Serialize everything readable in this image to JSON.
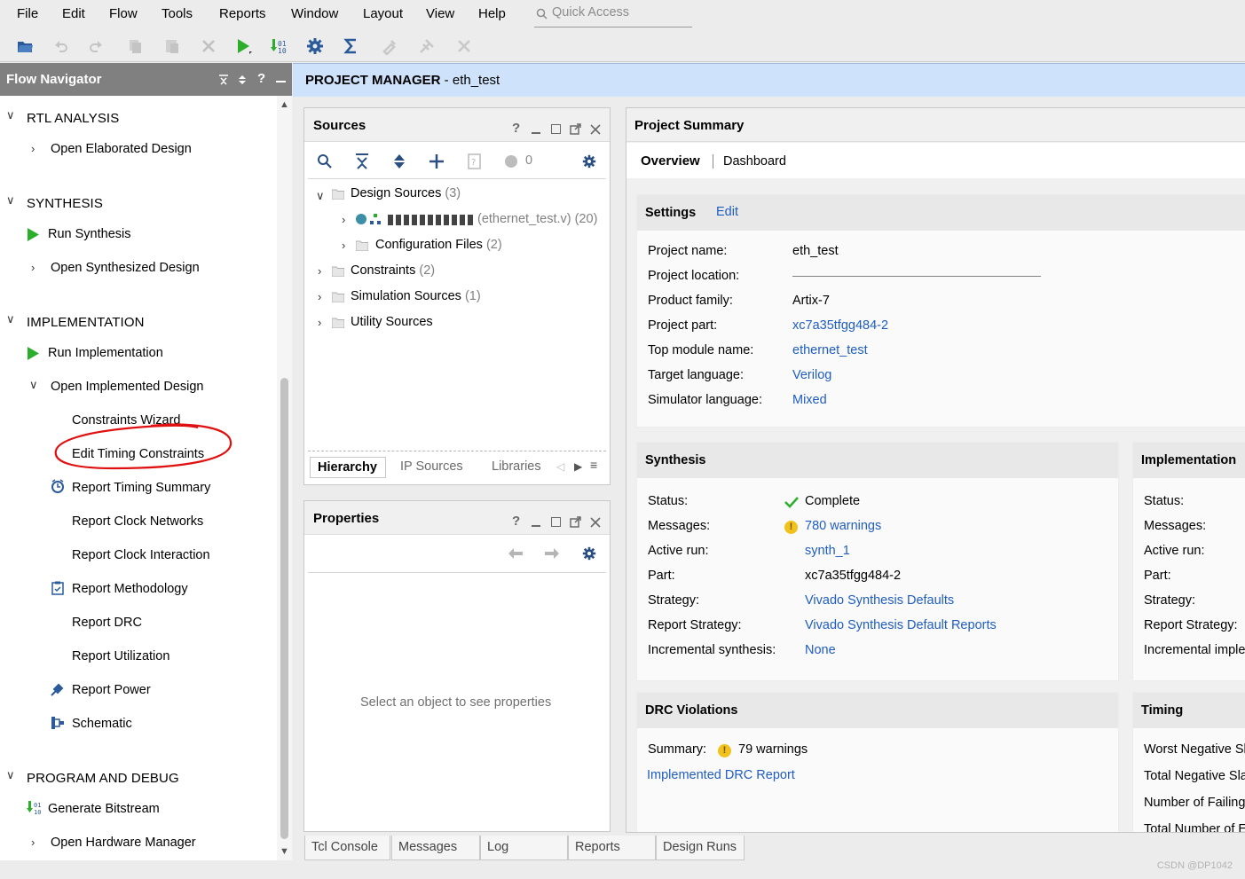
{
  "menu": [
    "File",
    "Edit",
    "Flow",
    "Tools",
    "Reports",
    "Window",
    "Layout",
    "View",
    "Help"
  ],
  "quick_access": "Quick Access",
  "flow_nav": {
    "title": "Flow Navigator",
    "rtl": "RTL ANALYSIS",
    "open_elab": "Open Elaborated Design",
    "synth": "SYNTHESIS",
    "run_synth": "Run Synthesis",
    "open_synth": "Open Synthesized Design",
    "impl": "IMPLEMENTATION",
    "run_impl": "Run Implementation",
    "open_impl": "Open Implemented Design",
    "constraints_wizard": "Constraints Wizard",
    "edit_timing": "Edit Timing Constraints",
    "report_timing": "Report Timing Summary",
    "report_clock_net": "Report Clock Networks",
    "report_clock_int": "Report Clock Interaction",
    "report_meth": "Report Methodology",
    "report_drc": "Report DRC",
    "report_util": "Report Utilization",
    "report_power": "Report Power",
    "schematic": "Schematic",
    "prog": "PROGRAM AND DEBUG",
    "gen_bit": "Generate Bitstream",
    "open_hw": "Open Hardware Manager"
  },
  "pm": {
    "title": "PROJECT MANAGER",
    "project": " - eth_test"
  },
  "sources": {
    "title": "Sources",
    "count": "0",
    "design_sources": "Design Sources",
    "design_count": "(3)",
    "eth_file": "(ethernet_test.v) (20)",
    "config_files": "Configuration Files",
    "config_count": "(2)",
    "constraints": "Constraints",
    "constraints_count": "(2)",
    "sim": "Simulation Sources",
    "sim_count": "(1)",
    "utility": "Utility Sources",
    "tabs": [
      "Hierarchy",
      "IP Sources",
      "Libraries"
    ]
  },
  "properties": {
    "title": "Properties",
    "empty": "Select an object to see properties"
  },
  "summary": {
    "title": "Project Summary",
    "tab_overview": "Overview",
    "tab_dashboard": "Dashboard",
    "settings": {
      "title": "Settings",
      "edit": "Edit",
      "labels": [
        "Project name:",
        "Project location:",
        "Product family:",
        "Project part:",
        "Top module name:",
        "Target language:",
        "Simulator language:"
      ],
      "project_name": "eth_test",
      "family": "Artix-7",
      "part": "xc7a35tfgg484-2",
      "top": "ethernet_test",
      "lang": "Verilog",
      "sim_lang": "Mixed"
    },
    "synthesis": {
      "title": "Synthesis",
      "labels": [
        "Status:",
        "Messages:",
        "Active run:",
        "Part:",
        "Strategy:",
        "Report Strategy:",
        "Incremental synthesis:"
      ],
      "status": "Complete",
      "messages": "780 warnings",
      "run": "synth_1",
      "part": "xc7a35tfgg484-2",
      "strategy": "Vivado Synthesis Defaults",
      "report_strategy": "Vivado Synthesis Default Reports",
      "incremental": "None"
    },
    "implementation": {
      "title": "Implementation",
      "labels": [
        "Status:",
        "Messages:",
        "Active run:",
        "Part:",
        "Strategy:",
        "Report Strategy:",
        "Incremental imple"
      ]
    },
    "drc": {
      "title": "DRC Violations",
      "summary_label": "Summary:",
      "summary": "79 warnings",
      "report": "Implemented DRC Report"
    },
    "timing": {
      "title": "Timing",
      "labels": [
        "Worst Negative Sl",
        "Total Negative Sla",
        "Number of Failing",
        "Total Number of E"
      ]
    }
  },
  "bottom_tabs": [
    "Tcl Console",
    "Messages",
    "Log",
    "Reports",
    "Design Runs"
  ],
  "watermark": "CSDN @DP1042"
}
